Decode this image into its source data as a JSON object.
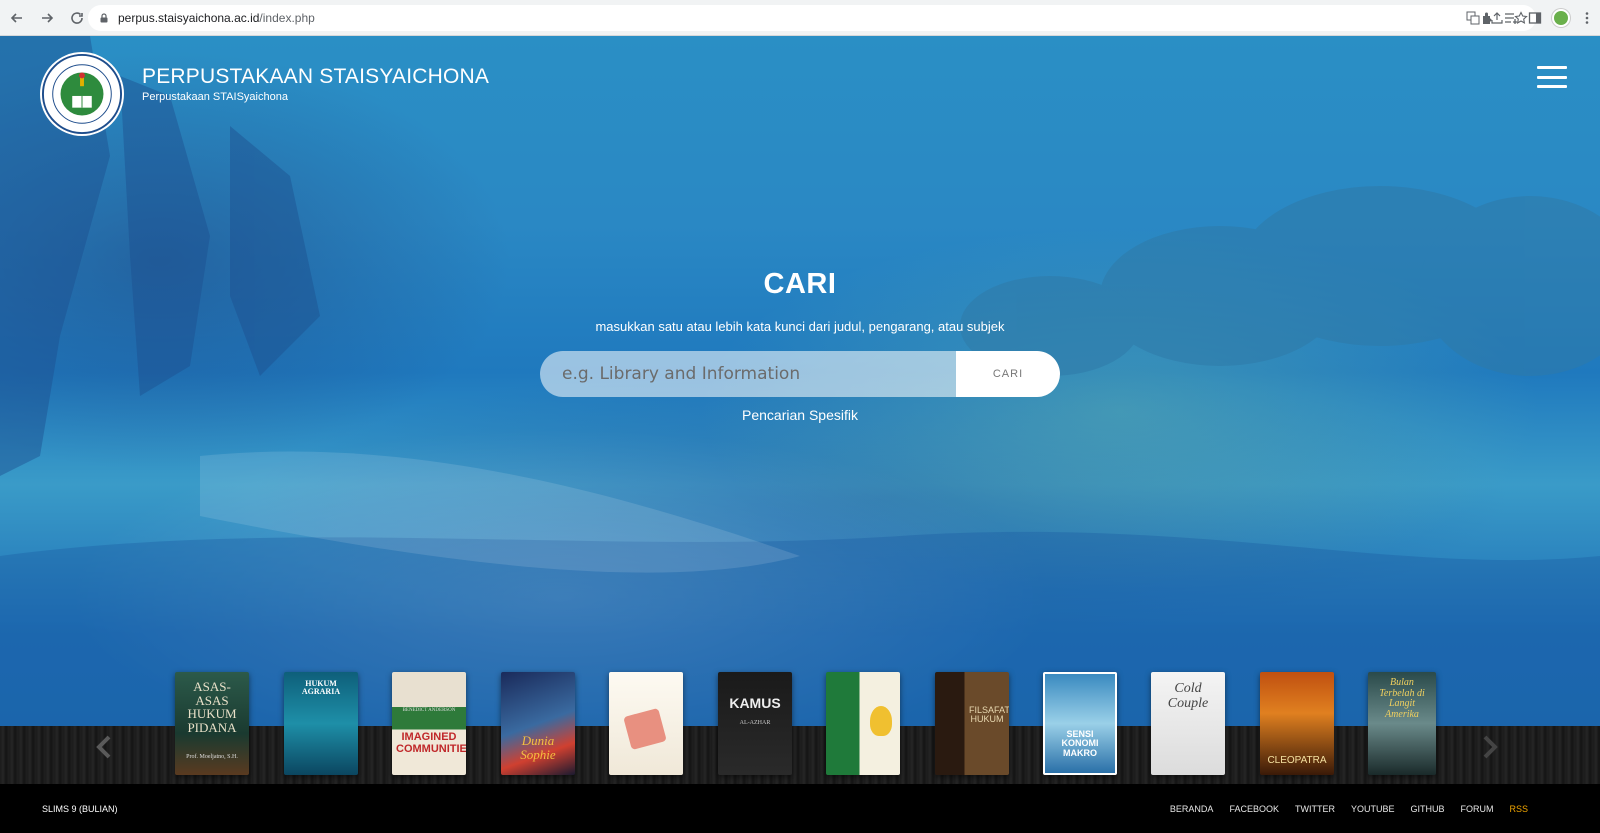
{
  "browser": {
    "url_host": "perpus.staisyaichona.ac.id",
    "url_path": "/index.php"
  },
  "header": {
    "title": "PERPUSTAKAAN STAISYAICHONA",
    "subtitle": "Perpustakaan STAISyaichona"
  },
  "search": {
    "title": "CARI",
    "hint": "masukkan satu atau lebih kata kunci dari judul, pengarang, atau subjek",
    "placeholder": "e.g. Library and Information",
    "button_label": "CARI",
    "advanced_link": "Pencarian Spesifik"
  },
  "books": [
    {
      "title": "ASAS-ASAS HUKUM PIDANA",
      "author": "Prof. Moeljatno, S.H."
    },
    {
      "title": "HUKUM AGRARIA",
      "author": ""
    },
    {
      "title": "IMAGINED COMMUNITIES",
      "author": "BENEDICT ANDERSON"
    },
    {
      "title": "Dunia Sophie",
      "author": ""
    },
    {
      "title": "",
      "author": ""
    },
    {
      "title": "KAMUS",
      "author": "AL-AZHAR"
    },
    {
      "title": "",
      "author": ""
    },
    {
      "title": "FILSAFAT HUKUM",
      "author": ""
    },
    {
      "title": "SENSI KONOMI MAKRO",
      "author": ""
    },
    {
      "title": "Cold Couple",
      "author": ""
    },
    {
      "title": "CLEOPATRA",
      "author": ""
    },
    {
      "title": "Bulan Terbelah di Langit Amerika",
      "author": ""
    }
  ],
  "footer": {
    "version": "SLIMS 9 (BULIAN)",
    "links": [
      "BERANDA",
      "FACEBOOK",
      "TWITTER",
      "YOUTUBE",
      "GITHUB",
      "FORUM",
      "RSS"
    ]
  },
  "icons": {
    "back": "arrow-left-icon",
    "forward": "arrow-right-icon",
    "reload": "reload-icon",
    "lock": "lock-icon",
    "menu": "hamburger-menu-icon",
    "prev": "chevron-left-icon",
    "next": "chevron-right-icon"
  },
  "colors": {
    "hero_blue": "#2a88c4",
    "rss": "#f0a500",
    "footer_bg": "#000000"
  }
}
